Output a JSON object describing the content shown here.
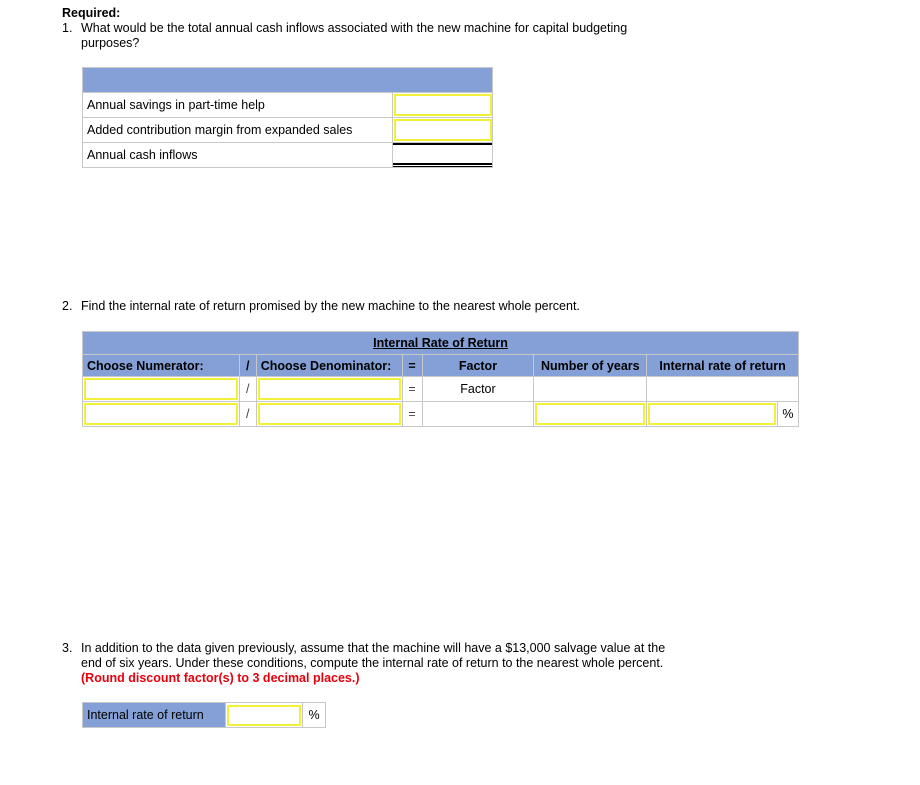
{
  "required_label": "Required:",
  "q1": {
    "number": "1.",
    "text": "What would be the total annual cash inflows associated with the new machine for capital budgeting purposes?",
    "table": {
      "rows": [
        {
          "label": "Annual savings in part-time help",
          "value": ""
        },
        {
          "label": "Added contribution margin from expanded sales",
          "value": ""
        },
        {
          "label": "Annual cash inflows",
          "value": ""
        }
      ]
    }
  },
  "q2": {
    "number": "2.",
    "text": "Find the internal rate of return promised by the new machine to the nearest whole percent.",
    "table": {
      "title": "Internal Rate of Return",
      "headers": {
        "numerator": "Choose Numerator:",
        "divide": "/",
        "denominator": "Choose Denominator:",
        "equals": "=",
        "factor": "Factor",
        "years": "Number of years",
        "irr": "Internal rate of return"
      },
      "row1": {
        "numerator": "",
        "divide": "/",
        "denominator": "",
        "equals": "=",
        "factor": "Factor"
      },
      "row2": {
        "numerator": "",
        "divide": "/",
        "denominator": "",
        "equals": "=",
        "years": "",
        "irr": "",
        "unit": "%"
      }
    }
  },
  "q3": {
    "number": "3.",
    "text": "In addition to the data given previously, assume that the machine will have a $13,000 salvage value at the end of six years. Under these conditions, compute the internal rate of return to the nearest whole percent.",
    "instruction": "(Round discount factor(s) to 3 decimal places.)",
    "field": {
      "label": "Internal rate of return",
      "value": "",
      "unit": "%"
    }
  },
  "colors": {
    "header_blue": "#84a0d6",
    "input_border": "#f3f03a",
    "instruction_red": "#e8000b"
  }
}
